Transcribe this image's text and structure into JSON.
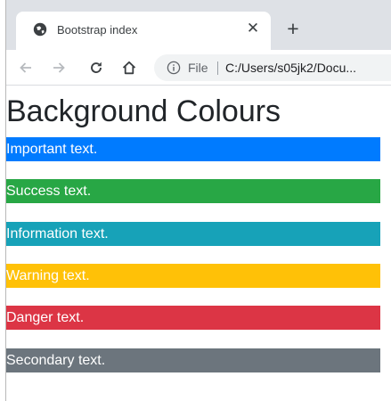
{
  "browser": {
    "tab": {
      "title": "Bootstrap index",
      "close_glyph": "✕",
      "favicon": "globe-icon"
    },
    "new_tab_glyph": "+",
    "toolbar": {
      "back": "arrow-left-icon",
      "forward": "arrow-right-icon",
      "reload": "reload-icon",
      "home": "home-icon"
    },
    "omnibox": {
      "security_icon": "info-icon",
      "chip_label": "File",
      "url": "C:/Users/s05jk2/Docu..."
    }
  },
  "page": {
    "heading": "Background Colours",
    "bars": [
      {
        "text": "Important text.",
        "color": "#007bff"
      },
      {
        "text": "Success text.",
        "color": "#28a745"
      },
      {
        "text": "Information text.",
        "color": "#17a2b8"
      },
      {
        "text": "Warning text.",
        "color": "#ffc107"
      },
      {
        "text": "Danger text.",
        "color": "#dc3545"
      },
      {
        "text": "Secondary text.",
        "color": "#6c757d"
      }
    ]
  }
}
